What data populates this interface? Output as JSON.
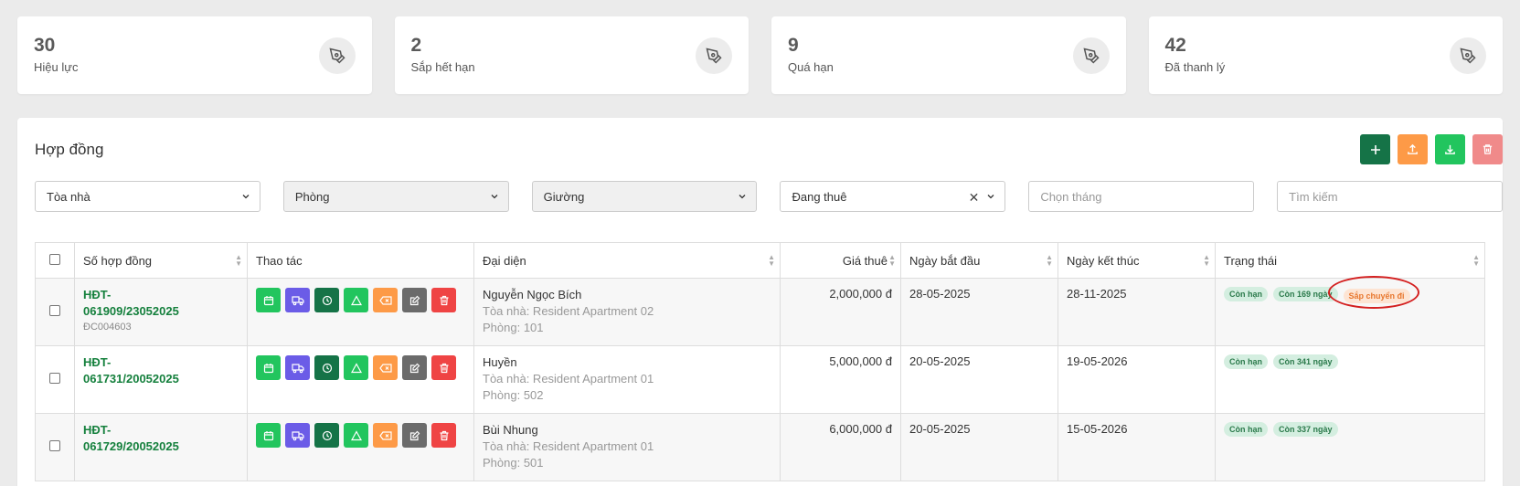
{
  "stats": [
    {
      "value": "30",
      "label": "Hiệu lực"
    },
    {
      "value": "2",
      "label": "Sắp hết hạn"
    },
    {
      "value": "9",
      "label": "Quá hạn"
    },
    {
      "value": "42",
      "label": "Đã thanh lý"
    }
  ],
  "panel": {
    "title": "Hợp đồng"
  },
  "action_colors": {
    "add": "#157347",
    "upload": "#fd9a47",
    "download": "#22c55e",
    "delete": "#f08a8a"
  },
  "filters": {
    "building": "Tòa nhà",
    "room": "Phòng",
    "bed": "Giường",
    "status": "Đang thuê",
    "month_placeholder": "Chọn tháng",
    "search_placeholder": "Tìm kiếm"
  },
  "table": {
    "headers": {
      "contract": "Số hợp đồng",
      "actions": "Thao tác",
      "rep": "Đại diện",
      "price": "Giá thuê",
      "start": "Ngày bắt đầu",
      "end": "Ngày kết thúc",
      "status": "Trạng thái"
    },
    "rows": [
      {
        "code_line1": "HĐT-",
        "code_line2": "061909/23052025",
        "code_sub": "ĐC004603",
        "name": "Nguyễn Ngọc Bích",
        "building": "Tòa nhà: Resident Apartment 02",
        "room": "Phòng: 101",
        "price": "2,000,000 đ",
        "start": "28-05-2025",
        "end": "28-11-2025",
        "tag1": "Còn hạn",
        "tag2": "Còn 169 ngày",
        "tag3": "Sắp chuyển đi"
      },
      {
        "code_line1": "HĐT-",
        "code_line2": "061731/20052025",
        "name": "Huyền",
        "building": "Tòa nhà: Resident Apartment 01",
        "room": "Phòng: 502",
        "price": "5,000,000 đ",
        "start": "20-05-2025",
        "end": "19-05-2026",
        "tag1": "Còn hạn",
        "tag2": "Còn 341 ngày"
      },
      {
        "code_line1": "HĐT-",
        "code_line2": "061729/20052025",
        "name": "Bùi Nhung",
        "building": "Tòa nhà: Resident Apartment 01",
        "room": "Phòng: 501",
        "price": "6,000,000 đ",
        "start": "20-05-2025",
        "end": "15-05-2026",
        "tag1": "Còn hạn",
        "tag2": "Còn 337 ngày"
      }
    ]
  }
}
